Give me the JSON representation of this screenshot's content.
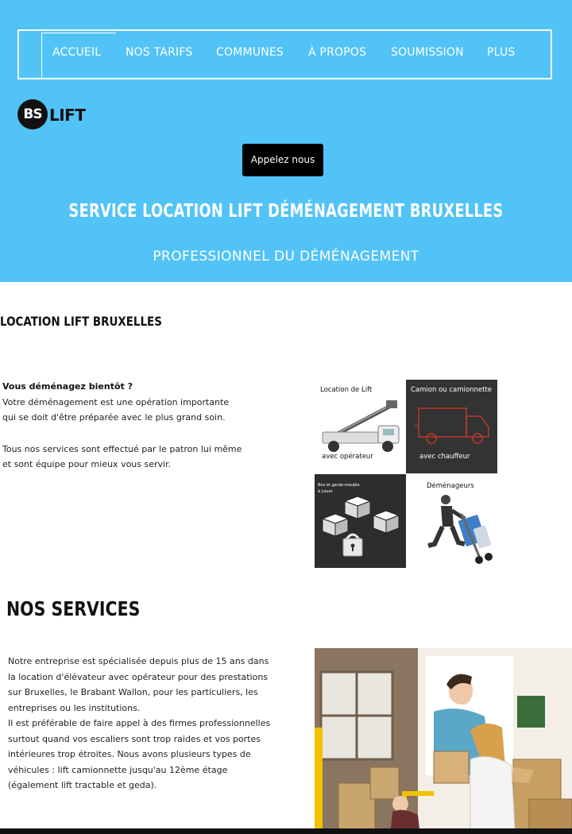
{
  "nav": {
    "items": [
      {
        "label": "ACCUEIL"
      },
      {
        "label": "NOS TARIFS"
      },
      {
        "label": "COMMUNES"
      },
      {
        "label": "À PROPOS"
      },
      {
        "label": "SOUMISSION"
      },
      {
        "label": "PLUS"
      }
    ]
  },
  "logo": {
    "mark": "BS",
    "text": "LIFT"
  },
  "hero": {
    "cta_label": "Appelez nous",
    "title": "SERVICE LOCATION LIFT DÉMÉNAGEMENT BRUXELLES",
    "subtitle": "PROFESSIONNEL DU DÉMÉNAGEMENT",
    "color": "#52c3f7"
  },
  "section1": {
    "title": "LOCATION LIFT BRUXELLES",
    "lead": "Vous déménagez bientôt ?",
    "lines_a": [
      "Votre déménagement est une opération importante",
      "qui se doit d'être préparée avec le plus grand soin."
    ],
    "lines_b": [
      "Tous nos services sont effectué par le patron lui même",
      "et sont équipe pour mieux vous servir."
    ]
  },
  "services_grid": {
    "tiles": [
      {
        "top": "Location de Lift",
        "bottom": "avec opérateur",
        "icon": "lift-truck-icon"
      },
      {
        "top": "Camion ou camionnette",
        "bottom": "avec chauffeur",
        "icon": "van-icon"
      },
      {
        "top": "Box et garde-meuble\nà Louer",
        "bottom": "",
        "icon": "storage-lock-icon"
      },
      {
        "top": "Déménageurs",
        "bottom": "",
        "icon": "mover-icon"
      }
    ]
  },
  "section2": {
    "title": "NOS SERVICES",
    "lines": [
      "Notre entreprise est spécialisée depuis plus de 15 ans dans",
      "la location d'élévateur avec opérateur pour des prestations",
      "sur Bruxelles, le Brabant Wallon, pour les particuliers, les",
      "entreprises ou les institutions.",
      "Il est préférable de faire appel à des firmes professionnelles",
      "surtout quand vos escaliers sont trop raides et vos portes",
      "intérieures trop étroites. Nous avons plusieurs types de",
      "véhicules : lift camionnette jusqu'au 12ème étage",
      "(également lift tractable et geda)."
    ]
  }
}
